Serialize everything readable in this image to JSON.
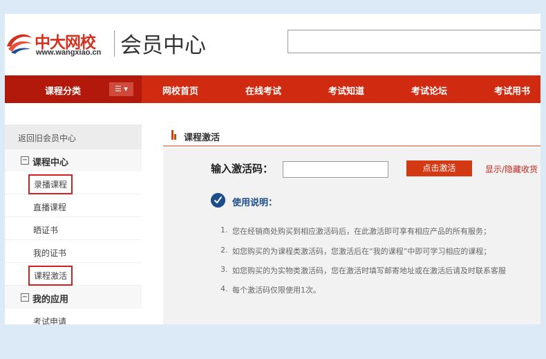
{
  "header": {
    "logo_text": "中大网校",
    "logo_url": "www.wangxiao.cn",
    "title": "会员中心",
    "search_placeholder": ""
  },
  "nav": {
    "category_label": "课程分类",
    "category_button": "☰ ▾",
    "items": [
      "网校首页",
      "在线考试",
      "考试知道",
      "考试论坛",
      "考试用书"
    ]
  },
  "sidebar": {
    "back_link": "返回旧会员中心",
    "sections": [
      {
        "title": "课程中心",
        "toggle": "−",
        "items": [
          "录播课程",
          "直播课程",
          "晒证书",
          "我的证书",
          "课程激活"
        ]
      },
      {
        "title": "我的应用",
        "toggle": "−",
        "items": [
          "考试申请"
        ]
      }
    ]
  },
  "content": {
    "title": "课程激活",
    "code_label": "输入激活码：",
    "code_value": "",
    "activate_button": "点击激活",
    "toggle_link": "显示/隐藏收货",
    "help_title": "使用说明：",
    "help_items": [
      {
        "num": "1.",
        "text": "您在经销商处购买到相应激活码后，在此激活即可享有相应产品的所有服务；"
      },
      {
        "num": "2.",
        "text": "如您购买的为课程类激活码，您激活后在“我的课程”中即可学习相应的课程；"
      },
      {
        "num": "3.",
        "text": "如您购买的为实物类激活码，您在激活时填写邮寄地址或在激活后请及时联系客服"
      },
      {
        "num": "4.",
        "text": "每个激活码仅限使用1次。"
      }
    ]
  },
  "colors": {
    "nav_red": "#d02a10",
    "nav_dark": "#b3190a",
    "accent_blue": "#1d4e8a",
    "highlight_box": "#d21f1f"
  }
}
